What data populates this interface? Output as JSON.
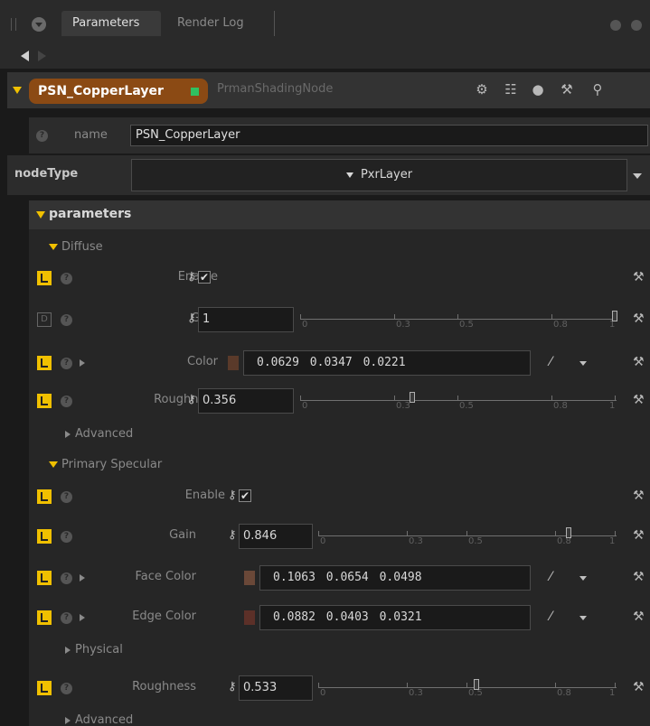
{
  "tabs": [
    {
      "label": "Parameters",
      "active": true
    },
    {
      "label": "Render Log",
      "active": false
    }
  ],
  "node": {
    "name": "PSN_CopperLayer",
    "type_label": "PrmanShadingNode",
    "header_icons": [
      "gear-icon",
      "hierarchy-icon",
      "comment-icon",
      "wrench-icon",
      "search-icon"
    ]
  },
  "name_field": {
    "label": "name",
    "value": "PSN_CopperLayer"
  },
  "node_type": {
    "label": "nodeType",
    "value": "PxrLayer"
  },
  "parameters_label": "parameters",
  "diffuse": {
    "label": "Diffuse",
    "enable": {
      "label": "Enable",
      "checked": true,
      "badge": "L"
    },
    "gain": {
      "label": "Gain",
      "value": "1",
      "level": 1.0,
      "badge": "D"
    },
    "color": {
      "label": "Color",
      "r": "0.0629",
      "g": "0.0347",
      "b": "0.0221",
      "badge": "L",
      "swatch": "#5a3a2a"
    },
    "roughness": {
      "label": "Roughness",
      "value": "0.356",
      "level": 0.356,
      "badge": "L"
    },
    "advanced": "Advanced"
  },
  "primary_specular": {
    "label": "Primary Specular",
    "enable": {
      "label": "Enable",
      "checked": true,
      "badge": "L"
    },
    "gain": {
      "label": "Gain",
      "value": "0.846",
      "level": 0.846,
      "badge": "L"
    },
    "face_color": {
      "label": "Face Color",
      "r": "0.1063",
      "g": "0.0654",
      "b": "0.0498",
      "badge": "L",
      "swatch": "#6a4838"
    },
    "edge_color": {
      "label": "Edge Color",
      "r": "0.0882",
      "g": "0.0403",
      "b": "0.0321",
      "badge": "L",
      "swatch": "#5c3028"
    },
    "physical": "Physical",
    "roughness": {
      "label": "Roughness",
      "value": "0.533",
      "level": 0.533,
      "badge": "L"
    },
    "advanced": "Advanced"
  },
  "slider_ticks": [
    "0",
    "0.3",
    "0.5",
    "0.8",
    "1"
  ],
  "slider_tick_values": [
    0,
    0.3,
    0.5,
    0.8,
    1
  ],
  "icons": {
    "key": "key-icon",
    "check": "✔",
    "picker": "eyedropper-icon",
    "wrench": "wrench-icon",
    "help": "?"
  },
  "colors": {
    "accent": "#f0c000",
    "node_badge": "#8b4a14",
    "status_dot": "#30c060"
  }
}
